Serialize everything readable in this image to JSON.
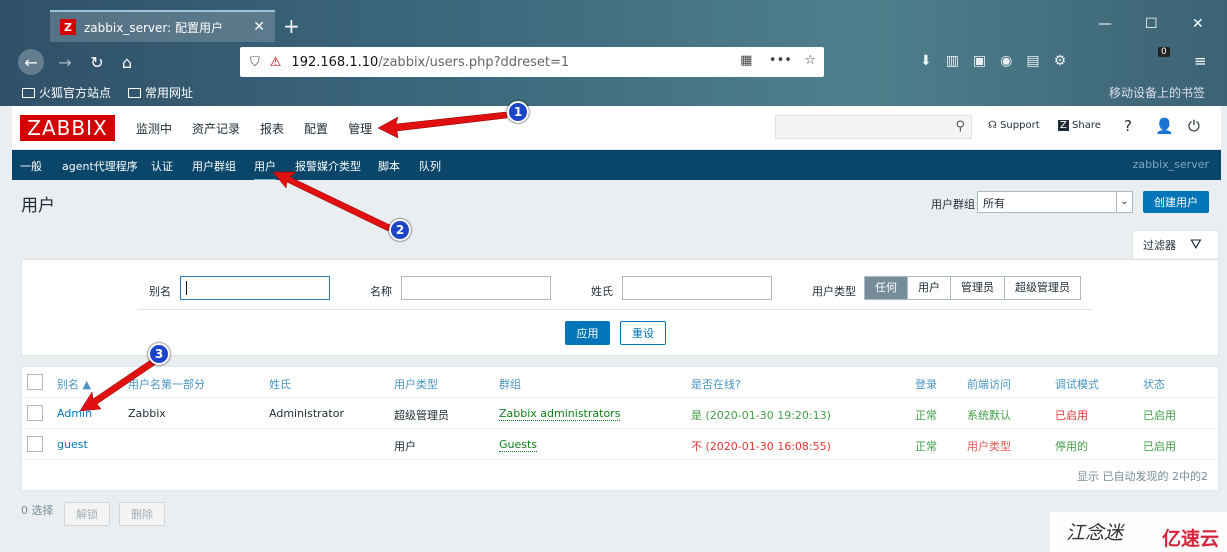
{
  "browser": {
    "tab_title": "zabbix_server: 配置用户",
    "tab_favicon": "Z",
    "url_host": "192.168.1.10",
    "url_path": "/zabbix/users.php?ddreset=1",
    "bookmark_1": "火狐官方站点",
    "bookmark_2": "常用网址",
    "bookmark_right": "移动设备上的书签",
    "extension_badge": "0"
  },
  "header": {
    "logo": "ZABBIX",
    "menu": [
      "监测中",
      "资产记录",
      "报表",
      "配置",
      "管理"
    ],
    "support": "Support",
    "share": "Share",
    "help": "?"
  },
  "submenu": {
    "items": [
      "一般",
      "agent代理程序",
      "认证",
      "用户群组",
      "用户",
      "报警媒介类型",
      "脚本",
      "队列"
    ],
    "server": "zabbix_server"
  },
  "page": {
    "title": "用户",
    "usergroup_label": "用户群组",
    "usergroup_value": "所有",
    "create_button": "创建用户",
    "filter_tab": "过滤器"
  },
  "filter": {
    "alias_label": "别名",
    "name_label": "名称",
    "surname_label": "姓氏",
    "type_label": "用户类型",
    "type_options": [
      "任何",
      "用户",
      "管理员",
      "超级管理员"
    ],
    "apply": "应用",
    "reset": "重设"
  },
  "table": {
    "headers": [
      "别名 ▲",
      "用户名第一部分",
      "姓氏",
      "用户类型",
      "群组",
      "是否在线?",
      "登录",
      "前端访问",
      "调试模式",
      "状态"
    ],
    "rows": [
      {
        "alias": "Admin",
        "name": "Zabbix",
        "surname": "Administrator",
        "type": "超级管理员",
        "groups": "Zabbix administrators",
        "online": "是 (2020-01-30 19:20:13)",
        "login": "正常",
        "frontend": "系统默认",
        "debug": "已启用",
        "status": "已启用"
      },
      {
        "alias": "guest",
        "name": "",
        "surname": "",
        "type": "用户",
        "groups": "Guests",
        "online": "不 (2020-01-30 16:08:55)",
        "login": "正常",
        "frontend": "用户类型",
        "debug": "停用的",
        "status": "已启用"
      }
    ],
    "footer": "显示 已自动发现的 2中的2"
  },
  "actions": {
    "selected": "0 选择",
    "unblock": "解锁",
    "delete": "删除"
  },
  "annotations": {
    "badge1": "1",
    "badge2": "2",
    "badge3": "3"
  },
  "watermark": {
    "text1": "江念迷",
    "text2": "亿速云"
  },
  "colors": {
    "zabbix_red": "#d40000",
    "submenu_bg": "#0a466a",
    "primary_button": "#0275b8",
    "annotation_arrow": "#e01010",
    "annotation_badge": "#1d45c9"
  }
}
